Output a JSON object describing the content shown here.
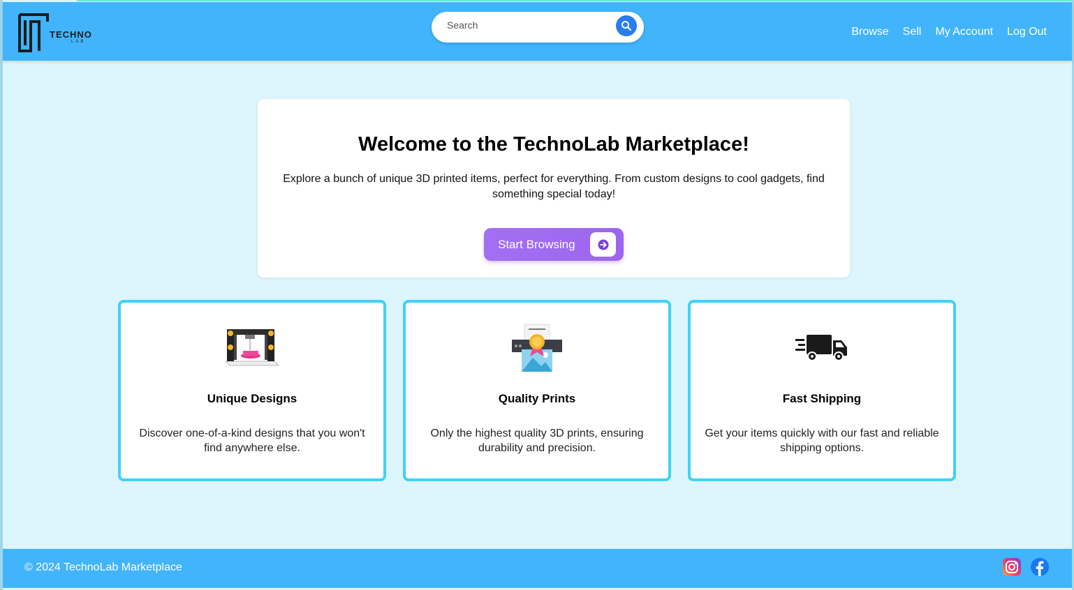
{
  "header": {
    "logo": {
      "word": "TECHNO",
      "sub": "LAB"
    },
    "search": {
      "placeholder": "Search"
    },
    "nav": [
      "Browse",
      "Sell",
      "My Account",
      "Log Out"
    ]
  },
  "hero": {
    "title": "Welcome to the TechnoLab Marketplace!",
    "text": "Explore a bunch of unique 3D printed items, perfect for everything. From custom designs to cool gadgets, find something special today!",
    "button": "Start Browsing"
  },
  "features": [
    {
      "title": "Unique Designs",
      "text": "Discover one-of-a-kind designs that you won't find anywhere else.",
      "icon": "3d-printer-icon"
    },
    {
      "title": "Quality Prints",
      "text": "Only the highest quality 3D prints, ensuring durability and precision.",
      "icon": "quality-print-icon"
    },
    {
      "title": "Fast Shipping",
      "text": "Get your items quickly with our fast and reliable shipping options.",
      "icon": "delivery-truck-icon"
    }
  ],
  "footer": {
    "copyright": "© 2024 TechnoLab Marketplace",
    "socials": [
      "instagram-icon",
      "facebook-icon"
    ]
  },
  "colors": {
    "header_bg": "#41b4fc",
    "page_bg": "#ddf5fc",
    "card_border": "#3ed2f7",
    "button": "#a26ff2",
    "search_button": "#2b7bf0"
  }
}
